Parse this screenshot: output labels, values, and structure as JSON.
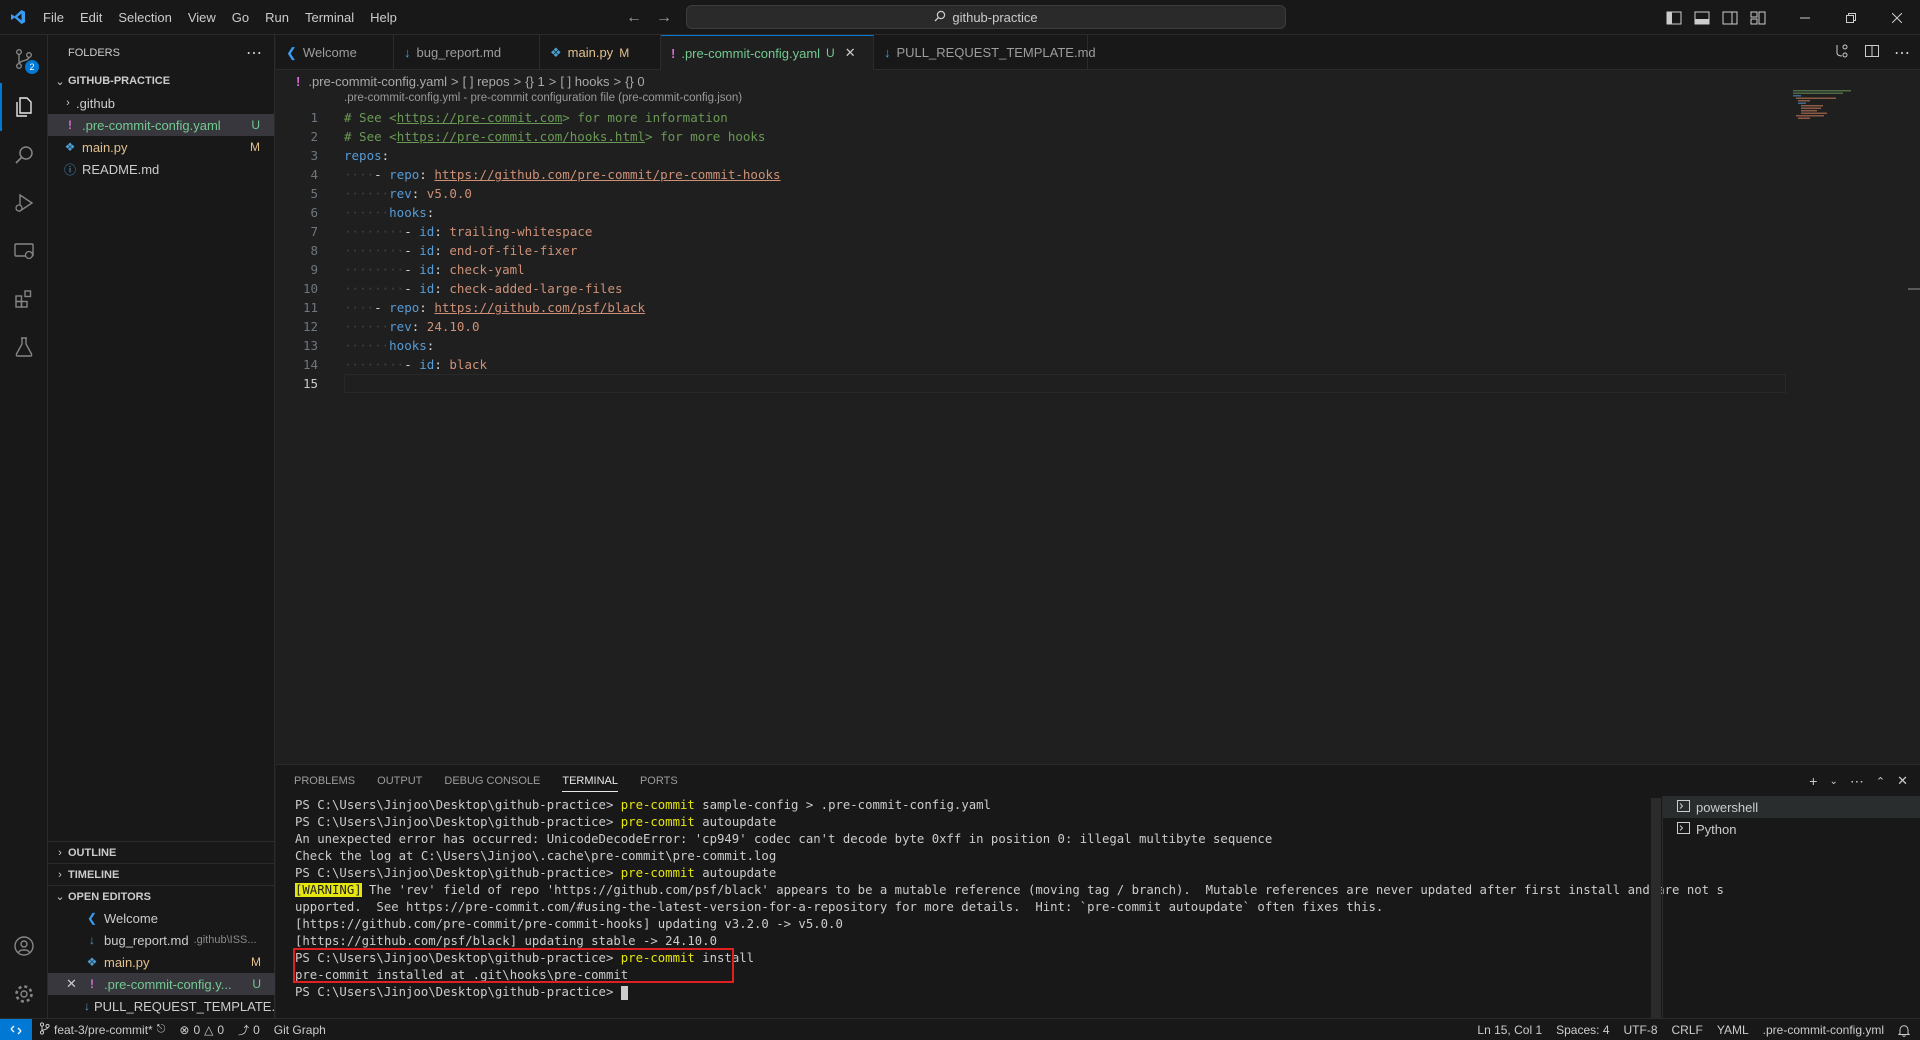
{
  "menu": [
    "File",
    "Edit",
    "Selection",
    "View",
    "Go",
    "Run",
    "Terminal",
    "Help"
  ],
  "command_center": "github-practice",
  "explorer": {
    "header": "FOLDERS",
    "root": "GITHUB-PRACTICE",
    "items": [
      {
        "label": ".github",
        "kind": "folder",
        "decoration": ""
      },
      {
        "label": ".pre-commit-config.yaml",
        "kind": "yaml",
        "decoration": "U"
      },
      {
        "label": "main.py",
        "kind": "python",
        "decoration": "M"
      },
      {
        "label": "README.md",
        "kind": "info",
        "decoration": ""
      }
    ],
    "outline": "OUTLINE",
    "timeline": "TIMELINE",
    "open_editors": "OPEN EDITORS",
    "open_items": [
      {
        "label": "Welcome",
        "extra": "",
        "decoration": ""
      },
      {
        "label": "bug_report.md",
        "extra": ".github\\ISS...",
        "decoration": ""
      },
      {
        "label": "main.py",
        "extra": "",
        "decoration": "M"
      },
      {
        "label": ".pre-commit-config.y...",
        "extra": "",
        "decoration": "U"
      },
      {
        "label": "PULL_REQUEST_TEMPLATE...",
        "extra": "",
        "decoration": ""
      }
    ]
  },
  "tabs": [
    {
      "label": "Welcome",
      "status": ""
    },
    {
      "label": "bug_report.md",
      "status": ""
    },
    {
      "label": "main.py",
      "status": "M"
    },
    {
      "label": ".pre-commit-config.yaml",
      "status": "U"
    },
    {
      "label": "PULL_REQUEST_TEMPLATE.md",
      "status": ""
    }
  ],
  "breadcrumb": [
    ".pre-commit-config.yaml",
    "[ ] repos",
    "{} 1",
    "[ ] hooks",
    "{} 0"
  ],
  "schema_hint": ".pre-commit-config.yml - pre-commit configuration file (pre-commit-config.json)",
  "line_numbers": [
    "1",
    "2",
    "3",
    "4",
    "5",
    "6",
    "7",
    "8",
    "9",
    "10",
    "11",
    "12",
    "13",
    "14",
    "15"
  ],
  "code": {
    "l1_hash": "# See <",
    "l1_url": "https://pre-commit.com",
    "l1_tail": "> for more information",
    "l2_hash": "# See <",
    "l2_url": "https://pre-commit.com/hooks.html",
    "l2_tail": "> for more hooks",
    "repos_key": "repos",
    "repo_key": "repo",
    "rev_key": "rev",
    "hooks_key": "hooks",
    "id_key": "id",
    "repo1_url": "https://github.com/pre-commit/pre-commit-hooks",
    "repo1_rev": "v5.0.0",
    "hook_ids": [
      "trailing-whitespace",
      "end-of-file-fixer",
      "check-yaml",
      "check-added-large-files"
    ],
    "repo2_url": "https://github.com/psf/black",
    "repo2_rev": "24.10.0",
    "hook2_id": "black"
  },
  "panel": {
    "tabs": [
      "PROBLEMS",
      "OUTPUT",
      "DEBUG CONSOLE",
      "TERMINAL",
      "PORTS"
    ],
    "active_tab": "TERMINAL"
  },
  "terminal": {
    "prompt": "PS C:\\Users\\Jinjoo\\Desktop\\github-practice>",
    "l1_cmd": "pre-commit",
    "l1_args": " sample-config > .pre-commit-config.yaml",
    "l2_cmd": "pre-commit",
    "l2_args": " autoupdate",
    "l3": "An unexpected error has occurred: UnicodeDecodeError: 'cp949' codec can't decode byte 0xff in position 0: illegal multibyte sequence",
    "l4": "Check the log at C:\\Users\\Jinjoo\\.cache\\pre-commit\\pre-commit.log",
    "l5_cmd": "pre-commit",
    "l5_args": " autoupdate",
    "warn_tag": "[WARNING]",
    "l6": " The 'rev' field of repo 'https://github.com/psf/black' appears to be a mutable reference (moving tag / branch).  Mutable references are never updated after first install and are not s",
    "l7": "upported.  See https://pre-commit.com/#using-the-latest-version-for-a-repository for more details.  Hint: `pre-commit autoupdate` often fixes this.",
    "l8": "[https://github.com/pre-commit/pre-commit-hooks] updating v3.2.0 -> v5.0.0",
    "l9": "[https://github.com/psf/black] updating stable -> 24.10.0",
    "l10_cmd": "pre-commit",
    "l10_args": " install",
    "l11": "pre-commit installed at .git\\hooks\\pre-commit"
  },
  "terminal_list": [
    "powershell",
    "Python"
  ],
  "status": {
    "branch": "feat-3/pre-commit*",
    "errors": "0",
    "warnings": "0",
    "ports": "0",
    "git_graph": "Git Graph",
    "position": "Ln 15, Col 1",
    "spaces": "Spaces: 4",
    "encoding": "UTF-8",
    "eol": "CRLF",
    "language": "YAML",
    "schema": ".pre-commit-config.yml"
  },
  "colors": {
    "accent": "#0078d4",
    "highlight_box": "#e02020",
    "warning_bg": "#e5e510"
  }
}
